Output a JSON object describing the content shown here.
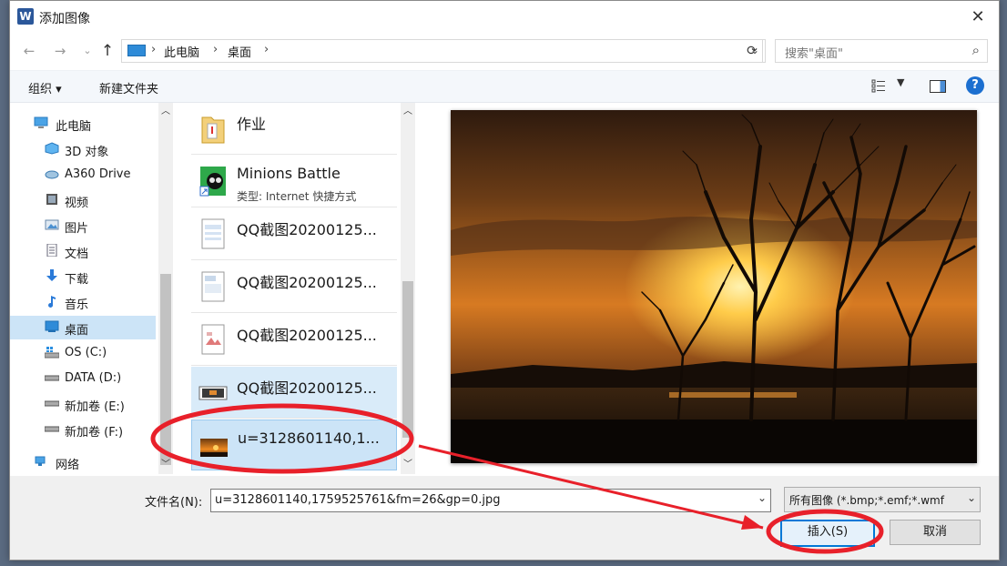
{
  "window": {
    "title": "添加图像",
    "app_icon_glyph": "W"
  },
  "nav": {
    "back_icon": "←",
    "forward_icon": "→",
    "recent_icon": "⌄",
    "up_icon": "↑",
    "crumbs": [
      "此电脑",
      "桌面"
    ],
    "sep": "›",
    "refresh_icon": "⟳",
    "search_placeholder": "搜索\"桌面\""
  },
  "toolbar": {
    "organize": "组织 ▾",
    "new_folder": "新建文件夹",
    "help": "?"
  },
  "sidebar": {
    "items": [
      {
        "label": "此电脑",
        "icon": "computer-icon"
      },
      {
        "label": "3D 对象",
        "icon": "3d-objects-icon"
      },
      {
        "label": "A360 Drive",
        "icon": "cloud-drive-icon"
      },
      {
        "label": "视频",
        "icon": "video-icon"
      },
      {
        "label": "图片",
        "icon": "pictures-icon"
      },
      {
        "label": "文档",
        "icon": "documents-icon"
      },
      {
        "label": "下载",
        "icon": "downloads-icon"
      },
      {
        "label": "音乐",
        "icon": "music-icon"
      },
      {
        "label": "桌面",
        "icon": "desktop-icon",
        "selected": true
      },
      {
        "label": "OS (C:)",
        "icon": "windows-drive-icon"
      },
      {
        "label": "DATA (D:)",
        "icon": "drive-icon"
      },
      {
        "label": "新加卷 (E:)",
        "icon": "drive-icon"
      },
      {
        "label": "新加卷 (F:)",
        "icon": "drive-icon"
      },
      {
        "label": "网络",
        "icon": "network-icon"
      }
    ]
  },
  "files": [
    {
      "name": "作业",
      "sub": "",
      "icon": "folder-file-icon"
    },
    {
      "name": "Minions Battle",
      "sub": "类型: Internet 快捷方式",
      "icon": "shortcut-icon"
    },
    {
      "name": "QQ截图20200125...",
      "sub": "",
      "icon": "image-doc-icon"
    },
    {
      "name": "QQ截图20200125...",
      "sub": "",
      "icon": "image-doc-icon"
    },
    {
      "name": "QQ截图20200125...",
      "sub": "",
      "icon": "image-doc-icon"
    },
    {
      "name": "QQ截图20200125...",
      "sub": "",
      "icon": "image-thumb-icon"
    },
    {
      "name": "u=3128601140,1...",
      "sub": "",
      "icon": "sunset-thumb-icon",
      "selected": true
    }
  ],
  "bottom": {
    "filename_label": "文件名(N):",
    "filename_value": "u=3128601140,1759525761&fm=26&gp=0.jpg",
    "filetype_value": "所有图像 (*.bmp;*.emf;*.wmf",
    "insert_label": "插入(S)",
    "cancel_label": "取消"
  },
  "colors": {
    "accent": "#0078d7",
    "selection": "#cce4f7",
    "annotation": "#e8202a"
  }
}
